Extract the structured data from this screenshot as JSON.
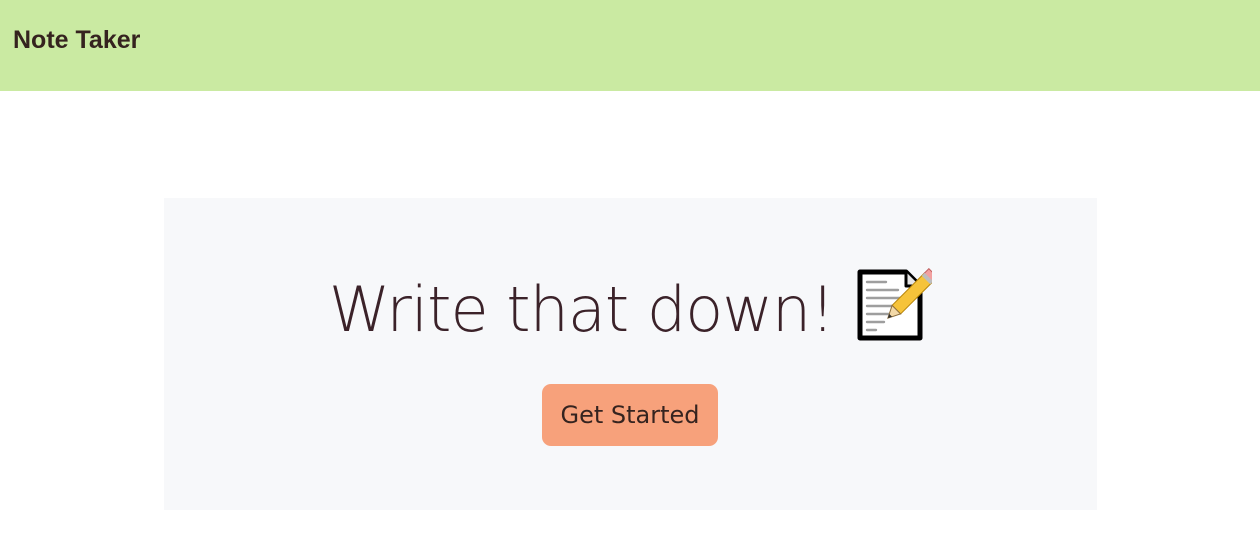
{
  "navbar": {
    "brand": "Note Taker",
    "background_color": "#caeaa2"
  },
  "hero": {
    "headline": "Write that down!",
    "icon": "memo-icon",
    "button_label": "Get Started",
    "button_color": "#f7a17b",
    "panel_color": "#f7f8fa"
  }
}
